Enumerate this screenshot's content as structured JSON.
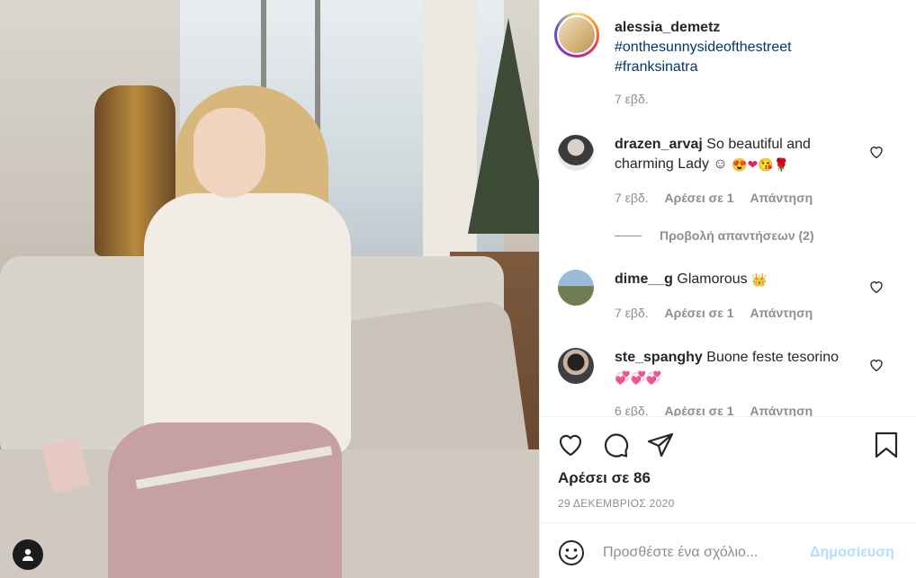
{
  "post": {
    "author": "alessia_demetz",
    "tags": [
      "#onthesunnysideofthestreet",
      "#franksinatra"
    ],
    "time": "7 εβδ."
  },
  "comments": [
    {
      "user": "drazen_arvaj",
      "text": "So beautiful and charming Lady ☺",
      "emojis": [
        "😍",
        "❤",
        "😘",
        "🌹"
      ],
      "time": "7 εβδ.",
      "likes": "Αρέσει σε 1",
      "reply": "Απάντηση"
    },
    {
      "user": "dime__g",
      "text": "Glamorous",
      "emojis": [
        "👑"
      ],
      "time": "7 εβδ.",
      "likes": "Αρέσει σε 1",
      "reply": "Απάντηση"
    },
    {
      "user": "ste_spanghy",
      "text": "Buone feste tesorino",
      "emojis": [
        "💞",
        "💞",
        "💞"
      ],
      "time": "6 εβδ.",
      "likes": "Αρέσει σε 1",
      "reply": "Απάντηση"
    }
  ],
  "view_replies": "Προβολή απαντήσεων (2)",
  "likes_count": "Αρέσει σε 86",
  "date": "29 ΔΕΚΕΜΒΡΙΟΣ 2020",
  "comment_box": {
    "placeholder": "Προσθέστε ένα σχόλιο...",
    "post_label": "Δημοσίευση"
  }
}
